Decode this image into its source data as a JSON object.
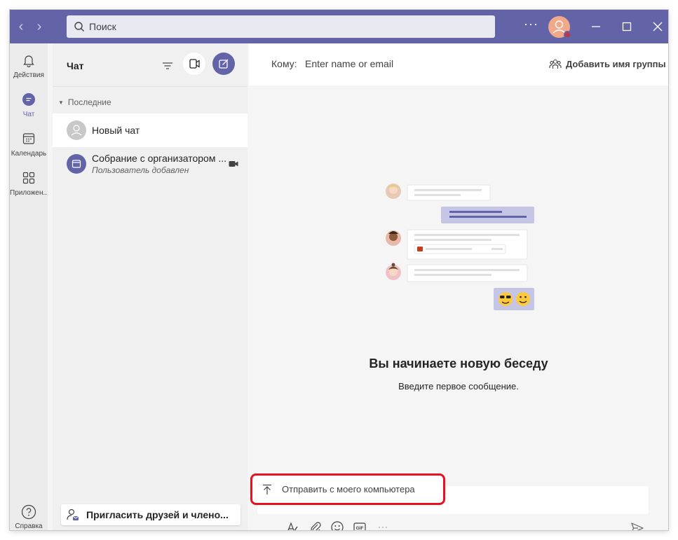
{
  "titlebar": {
    "search_placeholder": "Поиск",
    "more_label": "···"
  },
  "rail": {
    "items": [
      {
        "label": "Действия",
        "icon": "bell-icon"
      },
      {
        "label": "Чат",
        "icon": "chat-icon"
      },
      {
        "label": "Календарь",
        "icon": "calendar-icon"
      },
      {
        "label": "Приложен...",
        "icon": "apps-icon"
      }
    ],
    "help_label": "Справка"
  },
  "chat_panel": {
    "title": "Чат",
    "section_label": "Последние",
    "chats": [
      {
        "name": "Новый чат",
        "subtitle": ""
      },
      {
        "name": "Собрание с организатором ...",
        "subtitle": "Пользователь добавлен"
      }
    ],
    "invite_label": "Пригласить друзей и члено..."
  },
  "main": {
    "to_label": "Кому:",
    "to_placeholder": "Enter name or email",
    "add_group_label": "Добавить имя группы",
    "empty_title": "Вы начинаете новую беседу",
    "empty_subtitle": "Введите первое сообщение.",
    "upload_option_label": "Отправить с моего компьютера"
  },
  "colors": {
    "brand": "#6264a7",
    "highlight": "#e81123",
    "presence_busy": "#c4314b"
  }
}
